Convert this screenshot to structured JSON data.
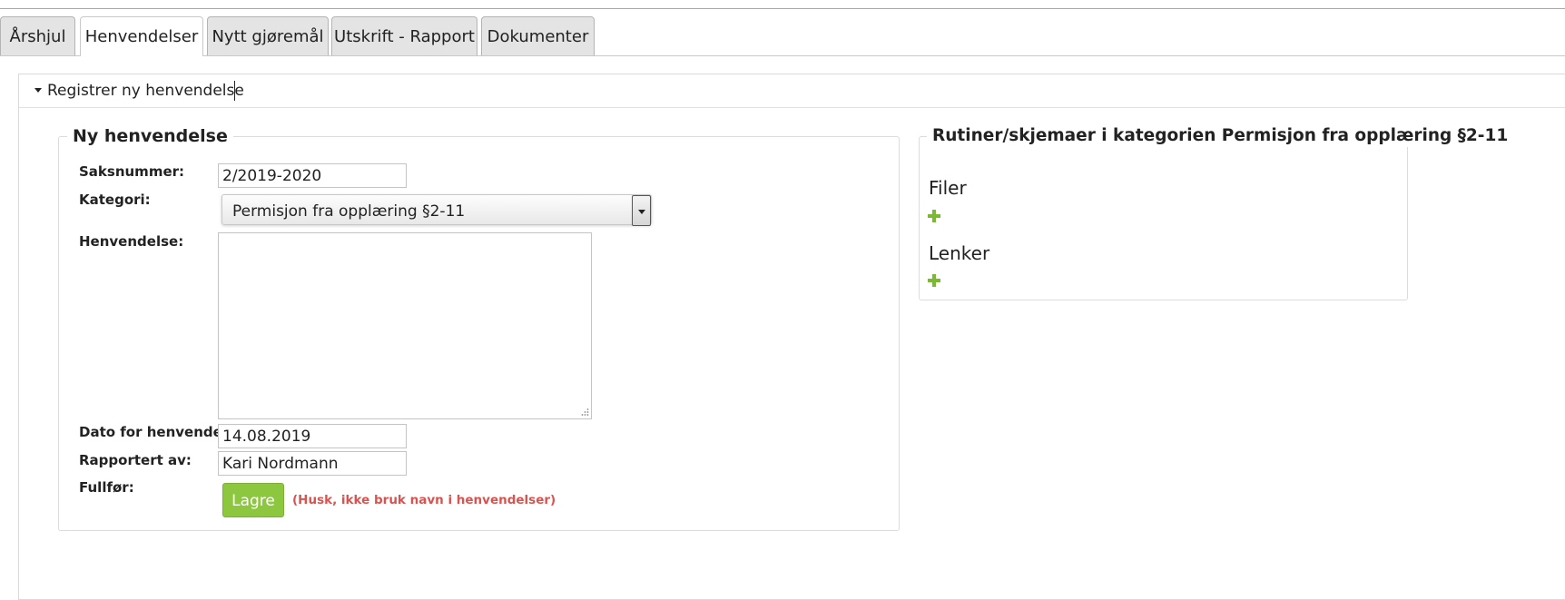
{
  "tabs": [
    {
      "label": "Årshjul",
      "active": false
    },
    {
      "label": "Henvendelser",
      "active": true
    },
    {
      "label": "Nytt gjøremål",
      "active": false
    },
    {
      "label": "Utskrift - Rapport",
      "active": false
    },
    {
      "label": "Dokumenter",
      "active": false
    }
  ],
  "panel": {
    "title": "Registrer ny henvendelse"
  },
  "form": {
    "legend": "Ny henvendelse",
    "saksnummer_label": "Saksnummer:",
    "saksnummer_value": "2/2019-2020",
    "kategori_label": "Kategori:",
    "kategori_value": "Permisjon fra opplæring §2-11",
    "henvendelse_label": "Henvendelse:",
    "henvendelse_value": "",
    "dato_label": "Dato for henvendelse:",
    "dato_value": "14.08.2019",
    "rapportert_label": "Rapportert av:",
    "rapportert_value": "Kari Nordmann",
    "fullfor_label": "Fullfør:",
    "save_label": "Lagre",
    "note": "(Husk, ikke bruk navn i henvendelser)"
  },
  "sidebar": {
    "legend": "Rutiner/skjemaer i kategorien Permisjon fra opplæring §2-11",
    "files_heading": "Filer",
    "links_heading": "Lenker"
  },
  "colors": {
    "accent_green": "#8dc63f",
    "plus_green": "#7cb832",
    "warning_red": "#d9534f",
    "tab_inactive": "#e4e4e4"
  },
  "icons": {
    "accordion": "caret-down-icon",
    "select": "chevron-down-icon",
    "add": "plus-icon",
    "textarea": "resize-grip-icon"
  }
}
